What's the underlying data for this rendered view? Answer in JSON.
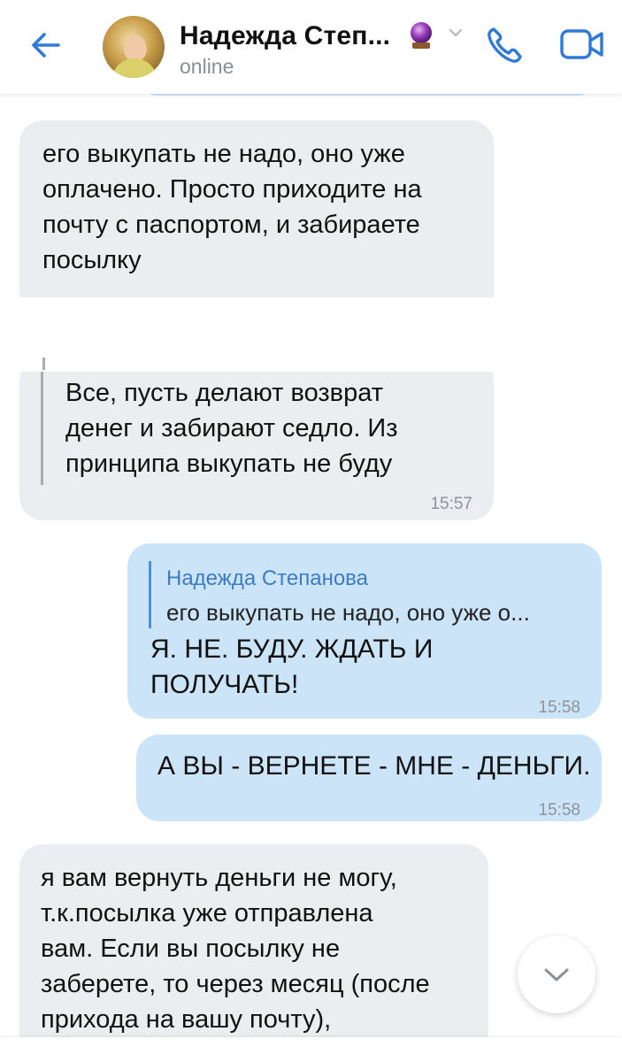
{
  "header": {
    "contact_name": "Надежда Степ...",
    "status": "online"
  },
  "messages": [
    {
      "direction": "incoming",
      "text": "его выкупать не надо, оно уже\nоплачено. Просто приходите на\nпочту с паспортом, и забираете\nпосылку"
    },
    {
      "direction": "incoming",
      "text": "Все, пусть делают возврат\nденег и забирают седло. Из\nпринципа выкупать не буду",
      "time": "15:57"
    },
    {
      "direction": "outgoing",
      "reply_name": "Надежда Степанова",
      "reply_text": "его выкупать не надо, оно уже о...",
      "text": "Я. НЕ. БУДУ. ЖДАТЬ И\nПОЛУЧАТЬ!",
      "time": "15:58"
    },
    {
      "direction": "outgoing",
      "text": "А ВЫ - ВЕРНЕТЕ - МНЕ - ДЕНЬГИ.",
      "time": "15:58"
    },
    {
      "direction": "incoming",
      "text": "я вам вернуть деньги не могу,\nт.к.посылка уже отправлена\nвам. Если вы посылку не\nзаберете, то через месяц (после\nприхода на вашу почту),"
    }
  ],
  "colors": {
    "incoming_bubble": "#ebedf0",
    "outgoing_bubble": "#cce4f7",
    "accent": "#2f7ad6"
  },
  "icons": [
    "back-arrow-icon",
    "crystal-ball-icon",
    "chevron-down-icon",
    "phone-icon",
    "video-camera-icon",
    "scroll-down-icon"
  ]
}
